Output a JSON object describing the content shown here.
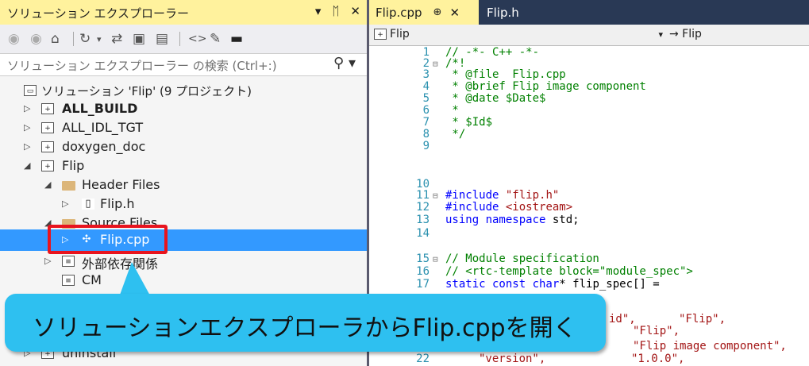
{
  "solution_explorer": {
    "title": "ソリューション エクスプローラー",
    "title_buttons": [
      "▾",
      "ᛖ",
      "✕"
    ],
    "search_placeholder": "ソリューション エクスプローラー の検索 (Ctrl+:)",
    "tree": {
      "solution": "ソリューション 'Flip' (9 プロジェクト)",
      "all_build": "ALL_BUILD",
      "all_idl_tgt": "ALL_IDL_TGT",
      "doxygen_doc": "doxygen_doc",
      "flip": "Flip",
      "header_files": "Header Files",
      "flip_h": "Flip.h",
      "source_files": "Source Files",
      "flip_cpp": "Flip.cpp",
      "external_deps_partial": "外部依存関係",
      "cmake_partial": "CM",
      "uninstall": "uninstall"
    }
  },
  "editor": {
    "tabs": [
      {
        "label": "Flip.cpp",
        "pin": "⊕",
        "close": "✕"
      },
      {
        "label": "Flip.h"
      }
    ],
    "nav_left": "Flip",
    "nav_right": "→ Flip",
    "line_numbers": [
      "1",
      "2",
      "3",
      "4",
      "5",
      "6",
      "7",
      "8",
      "9",
      "10",
      "11",
      "12",
      "13",
      "14",
      "15",
      "16",
      "17",
      "22"
    ],
    "lines": {
      "l1": "// -*- C++ -*-",
      "l2": "/*!",
      "l3": " * @file  Flip.cpp",
      "l4": " * @brief Flip image component",
      "l5": " * @date $Date$",
      "l6": " *",
      "l7": " * $Id$",
      "l8": " */",
      "l11_kw": "#include",
      "l11_str": " \"flip.h\"",
      "l12_kw": "#include",
      "l12_str": " <iostream>",
      "l13_kw": "using namespace",
      "l13_rest": " std;",
      "l15": "// Module specification",
      "l16": "// <rtc-template block=\"module_spec\">",
      "l17_kw": "static const char",
      "l17_rest": "* flip_spec[] =",
      "l18_tail": "id\",",
      "l18_str": "\"Flip\",",
      "l19_str": "\"Flip\",",
      "l20_str": "\"Flip image component\",",
      "l22_str": "\"version\",",
      "l22_val": "\"1.0.0\","
    }
  },
  "callout": {
    "text": "ソリューションエクスプローラからFlip.cppを開く"
  }
}
